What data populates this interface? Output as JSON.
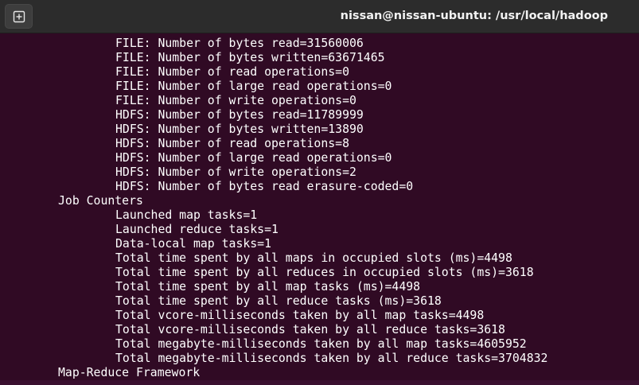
{
  "titlebar": {
    "title": "nissan@nissan-ubuntu: /usr/local/hadoop",
    "new_tab_icon": "new-tab-plus-icon"
  },
  "terminal": {
    "lines": [
      {
        "indent": 2,
        "text": "FILE: Number of bytes read=31560006"
      },
      {
        "indent": 2,
        "text": "FILE: Number of bytes written=63671465"
      },
      {
        "indent": 2,
        "text": "FILE: Number of read operations=0"
      },
      {
        "indent": 2,
        "text": "FILE: Number of large read operations=0"
      },
      {
        "indent": 2,
        "text": "FILE: Number of write operations=0"
      },
      {
        "indent": 2,
        "text": "HDFS: Number of bytes read=11789999"
      },
      {
        "indent": 2,
        "text": "HDFS: Number of bytes written=13890"
      },
      {
        "indent": 2,
        "text": "HDFS: Number of read operations=8"
      },
      {
        "indent": 2,
        "text": "HDFS: Number of large read operations=0"
      },
      {
        "indent": 2,
        "text": "HDFS: Number of write operations=2"
      },
      {
        "indent": 2,
        "text": "HDFS: Number of bytes read erasure-coded=0"
      },
      {
        "indent": 1,
        "text": "Job Counters"
      },
      {
        "indent": 2,
        "text": "Launched map tasks=1"
      },
      {
        "indent": 2,
        "text": "Launched reduce tasks=1"
      },
      {
        "indent": 2,
        "text": "Data-local map tasks=1"
      },
      {
        "indent": 2,
        "text": "Total time spent by all maps in occupied slots (ms)=4498"
      },
      {
        "indent": 2,
        "text": "Total time spent by all reduces in occupied slots (ms)=3618"
      },
      {
        "indent": 2,
        "text": "Total time spent by all map tasks (ms)=4498"
      },
      {
        "indent": 2,
        "text": "Total time spent by all reduce tasks (ms)=3618"
      },
      {
        "indent": 2,
        "text": "Total vcore-milliseconds taken by all map tasks=4498"
      },
      {
        "indent": 2,
        "text": "Total vcore-milliseconds taken by all reduce tasks=3618"
      },
      {
        "indent": 2,
        "text": "Total megabyte-milliseconds taken by all map tasks=4605952"
      },
      {
        "indent": 2,
        "text": "Total megabyte-milliseconds taken by all reduce tasks=3704832"
      },
      {
        "indent": 1,
        "text": "Map-Reduce Framework"
      }
    ]
  },
  "colors": {
    "terminal_bg": "#300a24",
    "titlebar_bg": "#2c2c2c",
    "text": "#ffffff"
  }
}
